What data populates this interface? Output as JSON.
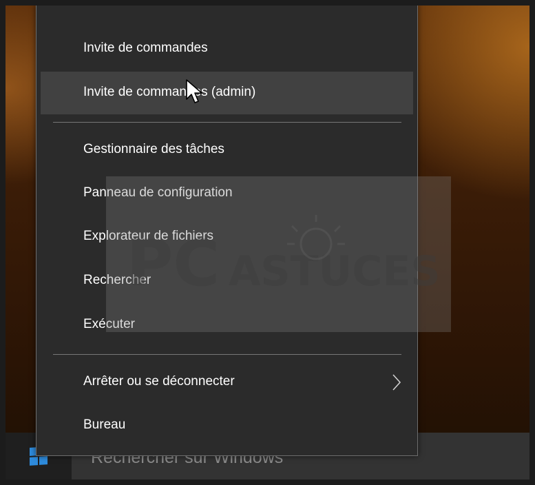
{
  "context_menu": {
    "items": [
      {
        "label": "Invite de commandes"
      },
      {
        "label": "Invite de commandes (admin)"
      },
      {
        "label": "Gestionnaire des tâches"
      },
      {
        "label": "Panneau de configuration"
      },
      {
        "label": "Explorateur de fichiers"
      },
      {
        "label": "Rechercher"
      },
      {
        "label": "Exécuter"
      },
      {
        "label": "Arrêter ou se déconnecter",
        "submenu_icon": "chevron-right-icon"
      },
      {
        "label": "Bureau"
      }
    ],
    "hovered_item": "Invite de commandes (admin)"
  },
  "taskbar": {
    "start_icon": "windows-logo-icon",
    "search_placeholder": "Rechercher sur Windows"
  },
  "watermark": {
    "brand_text": "PC ASTUCES",
    "icon": "lightbulb-icon"
  },
  "colors": {
    "menu_bg": "#2b2b2b",
    "hover_bg": "#414141",
    "accent_blue": "#2e8bdc",
    "taskbar_bg": "#2b2b2b",
    "search_bg": "#333333"
  }
}
